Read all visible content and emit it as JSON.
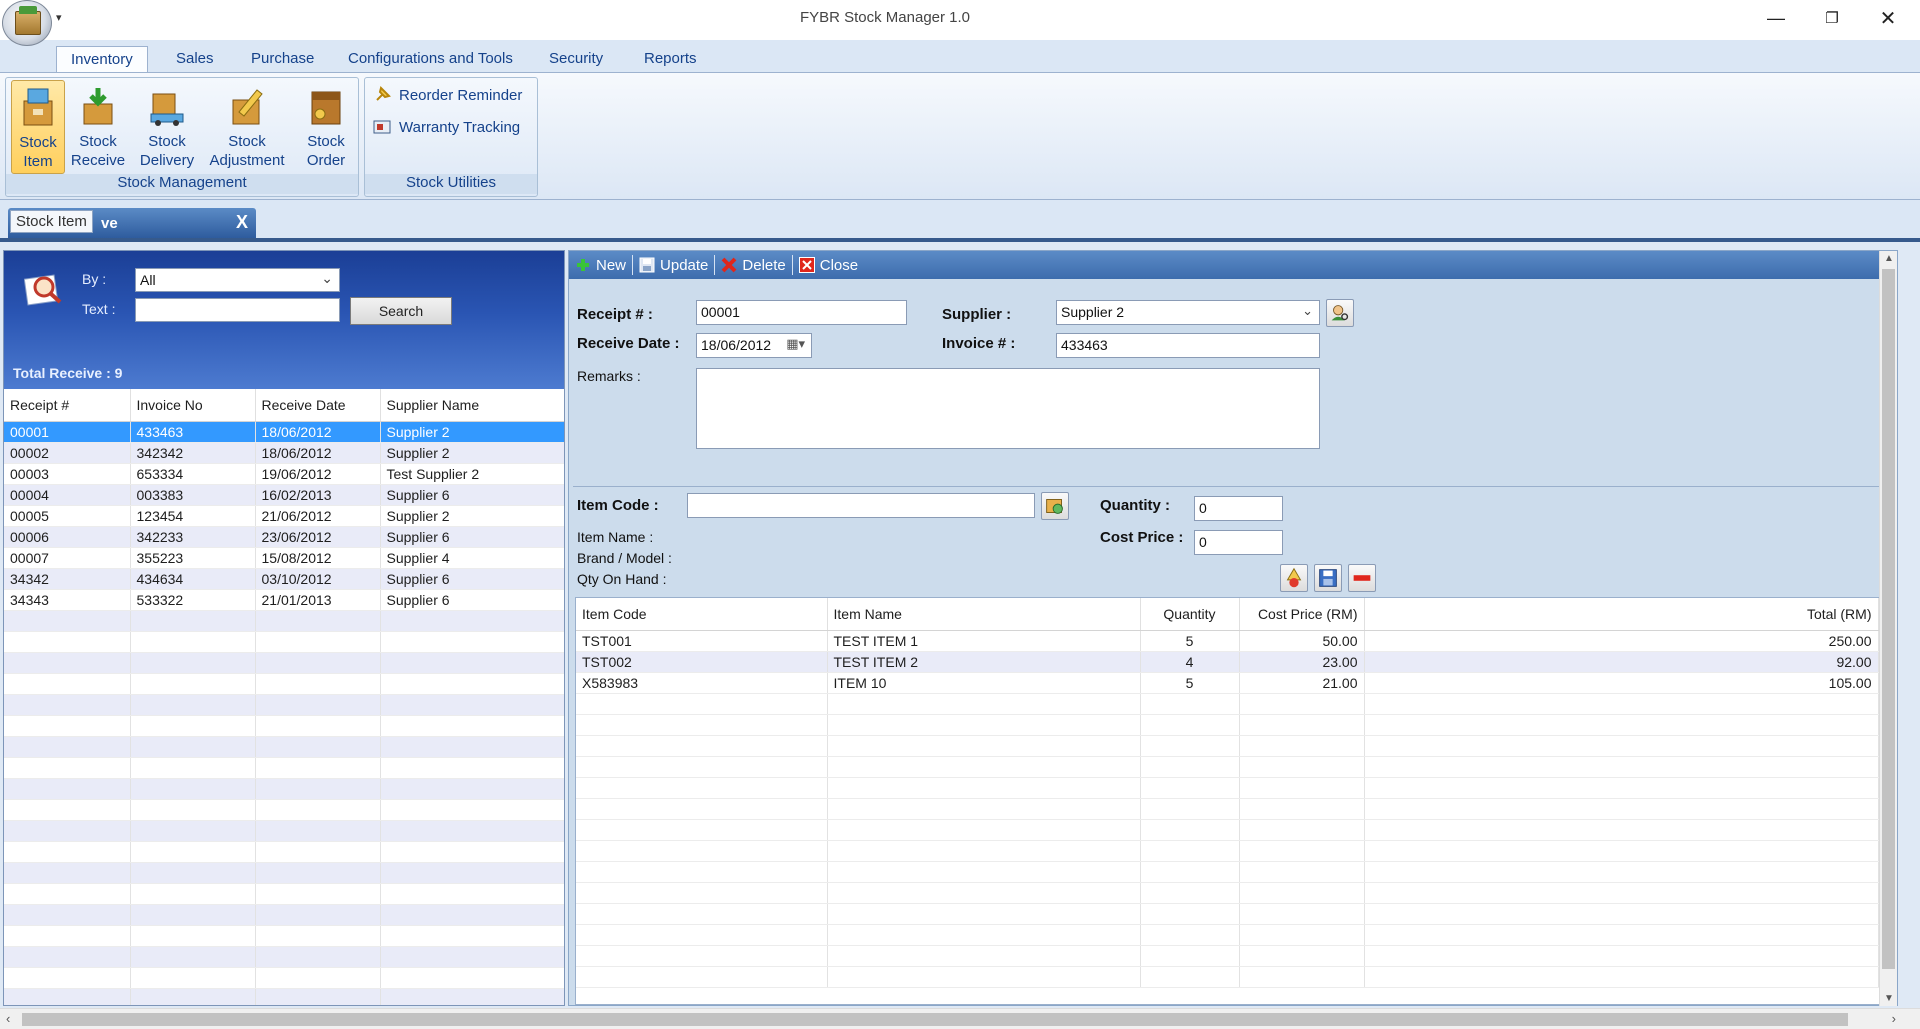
{
  "window": {
    "title": "FYBR Stock Manager 1.0"
  },
  "ribbon": {
    "tabs": [
      "Inventory",
      "Sales",
      "Purchase",
      "Configurations and Tools",
      "Security",
      "Reports"
    ],
    "active_tab": "Inventory",
    "stock_management": {
      "label": "Stock Management",
      "buttons": [
        {
          "line1": "Stock",
          "line2": "Item"
        },
        {
          "line1": "Stock",
          "line2": "Receive"
        },
        {
          "line1": "Stock",
          "line2": "Delivery"
        },
        {
          "line1": "Stock",
          "line2": "Adjustment"
        },
        {
          "line1": "Stock",
          "line2": "Order"
        }
      ]
    },
    "stock_utilities": {
      "label": "Stock Utilities",
      "buttons": [
        "Reorder Reminder",
        "Warranty Tracking"
      ]
    }
  },
  "doc_tab": {
    "label": "Stock Item",
    "behind_label": "ve",
    "close": "X"
  },
  "search": {
    "by_label": "By :",
    "by_value": "All",
    "text_label": "Text :",
    "text_value": "",
    "button": "Search",
    "total": "Total Receive : 9"
  },
  "receipts": {
    "columns": [
      "Receipt #",
      "Invoice No",
      "Receive Date",
      "Supplier Name"
    ],
    "rows": [
      [
        "00001",
        "433463",
        "18/06/2012",
        "Supplier 2"
      ],
      [
        "00002",
        "342342",
        "18/06/2012",
        "Supplier 2"
      ],
      [
        "00003",
        "653334",
        "19/06/2012",
        "Test Supplier 2"
      ],
      [
        "00004",
        "003383",
        "16/02/2013",
        "Supplier 6"
      ],
      [
        "00005",
        "123454",
        "21/06/2012",
        "Supplier 2"
      ],
      [
        "00006",
        "342233",
        "23/06/2012",
        "Supplier 6"
      ],
      [
        "00007",
        "355223",
        "15/08/2012",
        "Supplier 4"
      ],
      [
        "34342",
        "434634",
        "03/10/2012",
        "Supplier 6"
      ],
      [
        "34343",
        "533322",
        "21/01/2013",
        "Supplier 6"
      ]
    ],
    "selected_index": 0
  },
  "toolbar": {
    "new": "New",
    "update": "Update",
    "delete": "Delete",
    "close": "Close"
  },
  "form": {
    "receipt_label": "Receipt # :",
    "receipt_value": "00001",
    "supplier_label": "Supplier :",
    "supplier_value": "Supplier 2",
    "receive_date_label": "Receive Date :",
    "receive_date_value": "18/06/2012",
    "invoice_label": "Invoice # :",
    "invoice_value": "433463",
    "remarks_label": "Remarks :",
    "remarks_value": ""
  },
  "item_entry": {
    "item_code_label": "Item Code :",
    "item_code_value": "",
    "quantity_label": "Quantity :",
    "quantity_value": "0",
    "cost_price_label": "Cost Price :",
    "cost_price_value": "0",
    "item_name_label": "Item Name :",
    "brand_label": "Brand / Model :",
    "qty_on_hand_label": "Qty On Hand :"
  },
  "items": {
    "columns": [
      "Item Code",
      "Item Name",
      "Quantity",
      "Cost Price (RM)",
      "Total (RM)"
    ],
    "rows": [
      [
        "TST001",
        "TEST ITEM 1",
        "5",
        "50.00",
        "250.00"
      ],
      [
        "TST002",
        "TEST ITEM 2",
        "4",
        "23.00",
        "92.00"
      ],
      [
        "X583983",
        "ITEM 10",
        "5",
        "21.00",
        "105.00"
      ]
    ]
  },
  "colors": {
    "ribbon_text": "#15428b",
    "selection": "#3399ff",
    "alt_row": "#e9ebf8",
    "search_panel": "#2a55b3",
    "toolbar": "#4a7bbd"
  }
}
